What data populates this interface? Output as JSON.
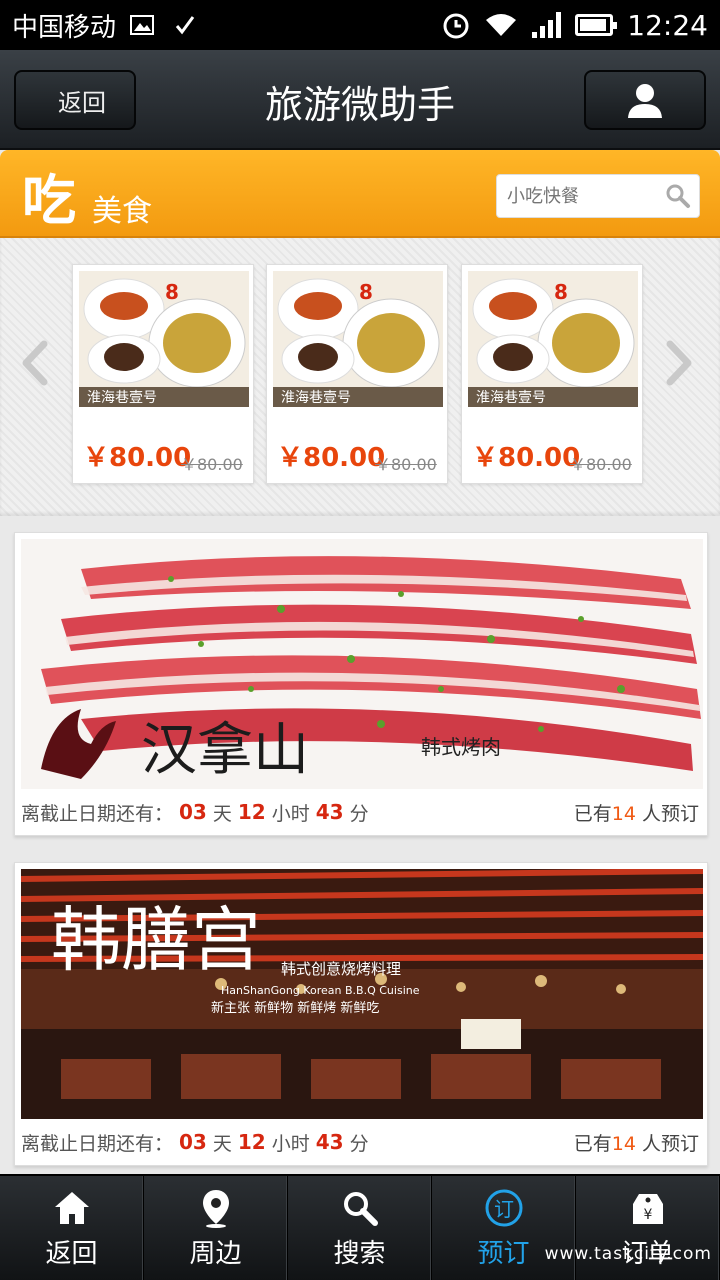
{
  "status_bar": {
    "carrier": "中国移动",
    "time": "12:24"
  },
  "nav": {
    "back_label": "返回",
    "title": "旅游微助手"
  },
  "category": {
    "icon_char": "吃",
    "label": "美食",
    "search_placeholder": "小吃快餐"
  },
  "deals": [
    {
      "price": "￥80.00",
      "old_price": "￥80.00",
      "img_text": "淮海巷壹号",
      "discount": "8"
    },
    {
      "price": "￥80.00",
      "old_price": "￥80.00",
      "img_text": "淮海巷壹号",
      "discount": "8"
    },
    {
      "price": "￥80.00",
      "old_price": "￥80.00",
      "img_text": "淮海巷壹号",
      "discount": "8"
    }
  ],
  "restaurants": [
    {
      "logo_text": "汉拿山",
      "tagline": "韩式烤肉",
      "deadline_prefix": "离截止日期还有：",
      "days": "03",
      "days_unit": "天",
      "hours": "12",
      "hours_unit": "小时",
      "minutes": "43",
      "minutes_unit": "分",
      "booked_prefix": "已有",
      "booked_count": "14",
      "booked_suffix": " 人预订"
    },
    {
      "logo_text": "韩膳宫",
      "tagline": "韩式创意烧烤料理",
      "subtitle": "HanShanGong Korean B.B.Q Cuisine",
      "slogan": "新主张 新鲜物 新鲜烤 新鲜吃",
      "deadline_prefix": "离截止日期还有：",
      "days": "03",
      "days_unit": "天",
      "hours": "12",
      "hours_unit": "小时",
      "minutes": "43",
      "minutes_unit": "分",
      "booked_prefix": "已有",
      "booked_count": "14",
      "booked_suffix": " 人预订"
    }
  ],
  "tabs": [
    {
      "label": "返回",
      "icon": "home-icon"
    },
    {
      "label": "周边",
      "icon": "location-pin-icon"
    },
    {
      "label": "搜索",
      "icon": "search-icon"
    },
    {
      "label": "预订",
      "icon": "book-icon",
      "icon_char": "订",
      "active": true
    },
    {
      "label": "订单",
      "icon": "price-tag-icon",
      "icon_char": "¥"
    }
  ],
  "watermark": "www.taskcity.com",
  "colors": {
    "accent_orange": "#f39a10",
    "price_red": "#e8450c",
    "active_tab_blue": "#22a2e8",
    "countdown_red": "#d62710"
  }
}
